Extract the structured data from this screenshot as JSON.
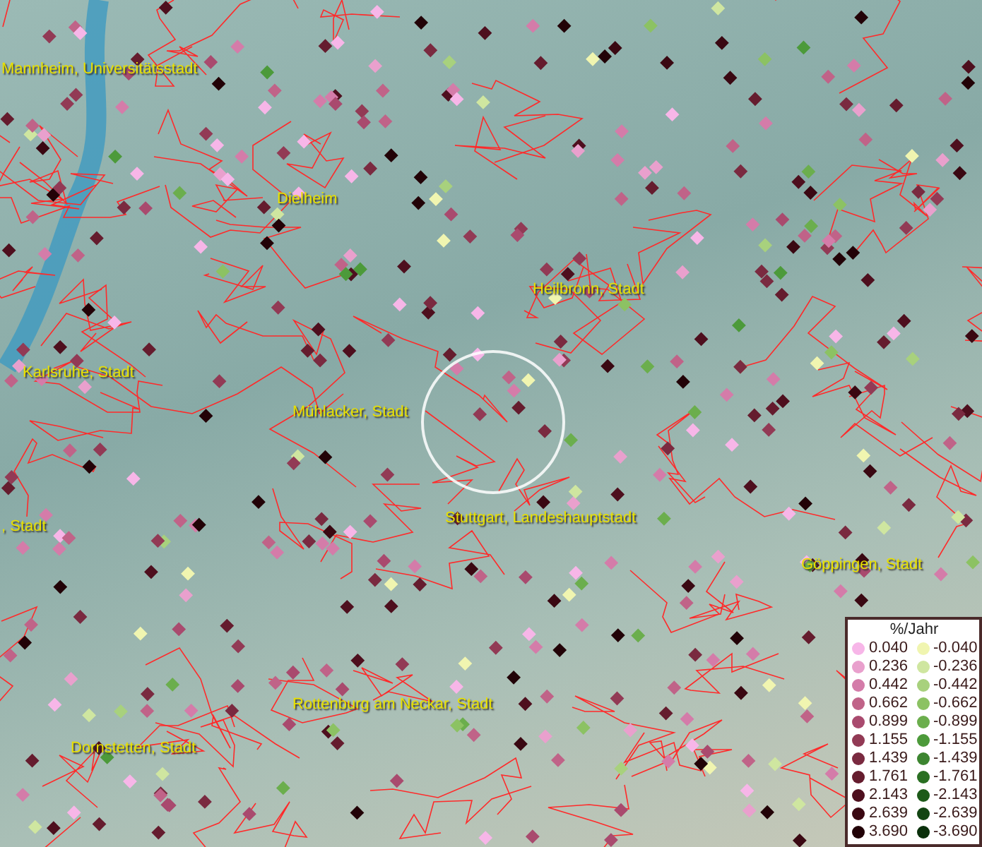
{
  "map": {
    "place_labels": [
      {
        "text": "Mannheim, Universitätsstadt"
      },
      {
        "text": "Dielheim"
      },
      {
        "text": "Heilbronn, Stadt"
      },
      {
        "text": "Karlsruhe, Stadt"
      },
      {
        "text": "Mühlacker, Stadt"
      },
      {
        "text": ", Stadt"
      },
      {
        "text": "Stuttgart, Landeshauptstadt"
      },
      {
        "text": "Göppingen, Stadt"
      },
      {
        "text": "Rottenburg am Neckar, Stadt"
      },
      {
        "text": "Dornstetten, Stadt"
      }
    ]
  },
  "legend": {
    "title": "%/Jahr",
    "increase": [
      {
        "value": "0.040",
        "color": "#f7b6e8"
      },
      {
        "value": "0.236",
        "color": "#e9a0cd"
      },
      {
        "value": "0.442",
        "color": "#d47ca9"
      },
      {
        "value": "0.662",
        "color": "#c06388"
      },
      {
        "value": "0.899",
        "color": "#a94a6e"
      },
      {
        "value": "1.155",
        "color": "#923a55"
      },
      {
        "value": "1.439",
        "color": "#7a2a40"
      },
      {
        "value": "1.761",
        "color": "#651c2e"
      },
      {
        "value": "2.143",
        "color": "#4e0f1e"
      },
      {
        "value": "2.639",
        "color": "#3a0812"
      },
      {
        "value": "3.690",
        "color": "#220207"
      }
    ],
    "decrease": [
      {
        "value": "-0.040",
        "color": "#f0f5b0"
      },
      {
        "value": "-0.236",
        "color": "#cfe6a0"
      },
      {
        "value": "-0.442",
        "color": "#a8d17d"
      },
      {
        "value": "-0.662",
        "color": "#8cc263"
      },
      {
        "value": "-0.899",
        "color": "#6bae4d"
      },
      {
        "value": "-1.155",
        "color": "#4c9a3a"
      },
      {
        "value": "-1.439",
        "color": "#3c8530"
      },
      {
        "value": "-1.761",
        "color": "#2a6f22"
      },
      {
        "value": "-2.143",
        "color": "#1d5a19"
      },
      {
        "value": "-2.639",
        "color": "#124512"
      },
      {
        "value": "-3.690",
        "color": "#0a300b"
      }
    ]
  }
}
